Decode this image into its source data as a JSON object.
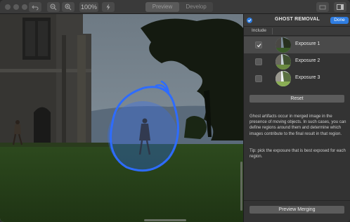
{
  "toolbar": {
    "zoom_value": "100%",
    "mode_tabs": [
      {
        "label": "Preview",
        "active": true
      },
      {
        "label": "Develop",
        "active": false
      }
    ]
  },
  "panel": {
    "title": "GHOST REMOVAL",
    "done_label": "Done",
    "include_label": "Include",
    "exposures": [
      {
        "label": "Exposure 1",
        "checked": true,
        "selected": true
      },
      {
        "label": "Exposure 2",
        "checked": false,
        "selected": false
      },
      {
        "label": "Exposure 3",
        "checked": false,
        "selected": false
      }
    ],
    "reset_label": "Reset",
    "description": "Ghost artifacts occur in merged image in the presence of moving objects. In such cases, you can define regions around them and determine which images contribute to the final result in that region.",
    "tip": "Tip: pick the exposure that is best exposed for each region.",
    "preview_label": "Preview Merging"
  },
  "colors": {
    "accent": "#2f7de1",
    "ghost_region": "#2e6cff"
  }
}
